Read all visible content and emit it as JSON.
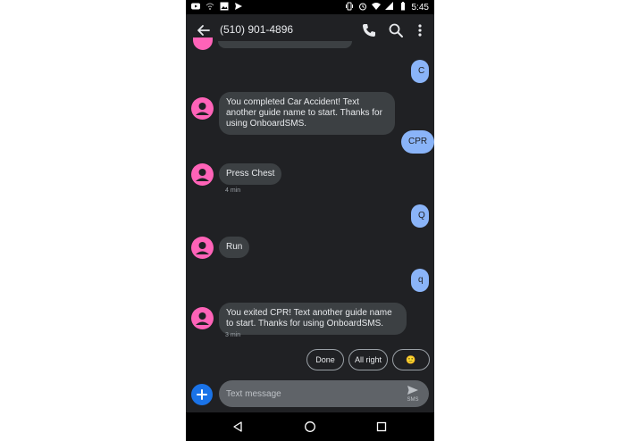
{
  "status_bar": {
    "time": "5:45",
    "left_icons": [
      "youtube-icon",
      "wifi-calling-icon",
      "image-icon",
      "send-icon"
    ],
    "right_icons": [
      "vibrate-icon",
      "alarm-icon",
      "wifi-icon",
      "signal-icon",
      "battery-icon"
    ]
  },
  "header": {
    "title": "(510) 901-4896",
    "actions": [
      "call-icon",
      "search-icon",
      "more-icon"
    ]
  },
  "messages": [
    {
      "direction": "out",
      "text": "C"
    },
    {
      "direction": "in",
      "text": "You completed Car Accident! Text another guide name to start. Thanks for using OnboardSMS."
    },
    {
      "direction": "out",
      "text": "CPR"
    },
    {
      "direction": "in",
      "text": "Press Chest",
      "timestamp": "4 min"
    },
    {
      "direction": "out",
      "text": "Q"
    },
    {
      "direction": "in",
      "text": "Run"
    },
    {
      "direction": "out",
      "text": "q"
    },
    {
      "direction": "in",
      "text": "You exited CPR! Text another guide name to start. Thanks for using OnboardSMS.",
      "timestamp": "3 min"
    }
  ],
  "suggestions": [
    {
      "label": "Done"
    },
    {
      "label": "All right"
    },
    {
      "label": "🙂"
    }
  ],
  "compose": {
    "placeholder": "Text message",
    "send_label": "SMS"
  },
  "colors": {
    "background": "#202124",
    "incoming_bubble": "#3c4043",
    "outgoing_bubble": "#8ab4f8",
    "avatar": "#ff63b8",
    "add_button": "#1a73e8"
  }
}
